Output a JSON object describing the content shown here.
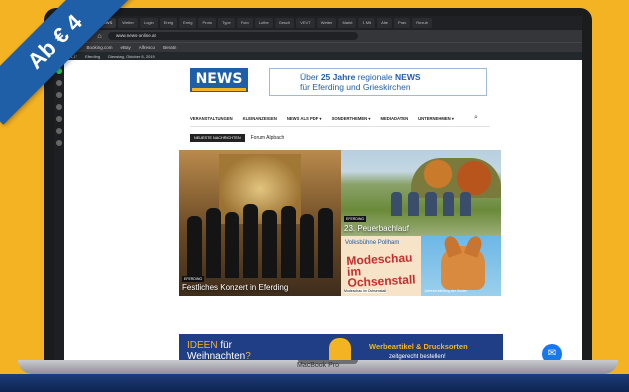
{
  "promo": {
    "ribbon": "Ab € 4"
  },
  "browser": {
    "tabs": [
      "14 M",
      "Ereig",
      "NEWS",
      "Wetter",
      "Login",
      "Ereig",
      "Ereig",
      "Proto",
      "Type",
      "Foto",
      "Lufbe",
      "Gesch",
      "VEVT",
      "Wetter",
      "Markt",
      "1 Mit",
      "Alte",
      "Prav",
      "Rezub"
    ],
    "url": "www.news-online.at",
    "bookmarks": [
      "Amazon",
      "Booking.com",
      "eBay",
      "Alfresco",
      "Beratn"
    ]
  },
  "wpbar": {
    "items": [
      "4,1°",
      "Eferding",
      "Dienstag, Oktober 8, 2019"
    ]
  },
  "site": {
    "logo": "NEWS",
    "banner_line1_pre": "Über",
    "banner_line1_years": "25 Jahre",
    "banner_line1_mid": "regionale",
    "banner_line1_brand": "NEWS",
    "banner_line2": "für Eferding und Grieskirchen",
    "menu": [
      "VERANSTALTUNGEN",
      "KLEINANZEIGEN",
      "NEWS ALS PDF ▾",
      "SONDERTHEMEN ▾",
      "MEDIADATEN",
      "UNTERNEHMEN ▾"
    ],
    "ticker_label": "NEUESTE NACHRICHTEN",
    "ticker_text": "Forum Alpbach"
  },
  "tiles": {
    "main_tag": "EFERDING",
    "main_caption": "Festliches Konzert in Eferding",
    "t2_tag": "EFERDING",
    "t2_caption": "23. Peuerbachlauf",
    "t3_sign": "Volksbühne Pollham",
    "t3_headline": "Modeschau im Ochsenstall",
    "t3_caption": "Modeschau im Ochsenstall",
    "t4_caption": "Jahreserzählung der Kinder"
  },
  "ad": {
    "line1": "IDEEN",
    "line1b": "für",
    "line2": "Weihnachten",
    "right1": "Werbeartikel & Drucksorten",
    "right2": "zeitgerecht bestellen!"
  },
  "device": {
    "label": "MacBook Pro"
  },
  "colors": {
    "brand_blue": "#1f5fa8",
    "accent_yellow": "#f4b323",
    "ad_blue": "#1f3e85"
  }
}
